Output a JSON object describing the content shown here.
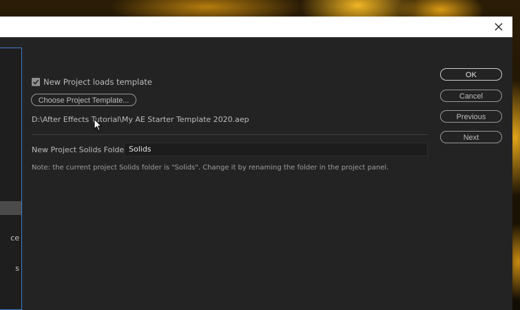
{
  "dialog": {
    "close_icon": "close-icon"
  },
  "sidebar": {
    "items": [
      {
        "label": "",
        "selected": true
      },
      {
        "label": "ce",
        "selected": false
      },
      {
        "label": "s",
        "selected": false
      }
    ]
  },
  "template": {
    "checkbox_label": "New Project loads template",
    "checked": true,
    "choose_button_label": "Choose Project Template...",
    "path": "D:\\After Effects Tutorial\\My AE Starter Template 2020.aep"
  },
  "solids": {
    "label": "New Project Solids Folder",
    "value": "Solids",
    "note": "Note: the current project Solids folder is \"Solids\". Change it by renaming the folder in the project panel."
  },
  "buttons": {
    "ok": "OK",
    "cancel": "Cancel",
    "previous": "Previous",
    "next": "Next"
  },
  "colors": {
    "dialog_bg": "#232323",
    "title_bar_bg": "#ffffff",
    "focus_border": "#3d7fd2"
  }
}
